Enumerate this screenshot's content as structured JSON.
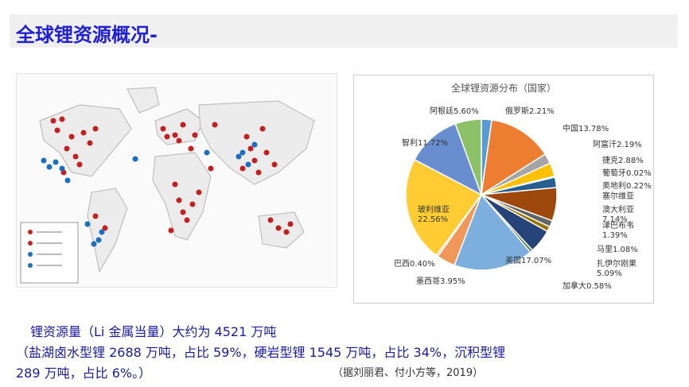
{
  "slide": {
    "title": "全球锂资源概况-"
  },
  "map": {
    "title": "",
    "deposit_colors": {
      "brine": "#1a6fc0",
      "hard_rock": "#c42020"
    }
  },
  "chart_data": {
    "type": "pie",
    "title": "全球锂资源分布（国家）",
    "slices": [
      {
        "label": "俄罗斯2.21%",
        "value": 2.21,
        "color": "#5b9bd5"
      },
      {
        "label": "中国13.78%",
        "value": 13.78,
        "color": "#ed7d31"
      },
      {
        "label": "阿富汗2.19%",
        "value": 2.19,
        "color": "#a5a5a5"
      },
      {
        "label": "捷克2.88%",
        "value": 2.88,
        "color": "#ffc000"
      },
      {
        "label": "葡萄牙0.02%",
        "value": 0.02,
        "color": "#4472c4"
      },
      {
        "label": "奥地利0.22%",
        "value": 0.22,
        "color": "#70ad47"
      },
      {
        "label": "塞尔维亚",
        "value": 2.2,
        "color": "#255e91"
      },
      {
        "label": "澳大利亚 7.14%",
        "value": 7.14,
        "color": "#9e480e"
      },
      {
        "label": "津巴布韦 1.39%",
        "value": 1.39,
        "color": "#636363"
      },
      {
        "label": "马里1.08%",
        "value": 1.08,
        "color": "#997300"
      },
      {
        "label": "扎伊尔刚果 5.09%",
        "value": 5.09,
        "color": "#264478"
      },
      {
        "label": "加拿大0.58%",
        "value": 0.58,
        "color": "#43682b"
      },
      {
        "label": "美国17.07%",
        "value": 17.07,
        "color": "#7cafdd"
      },
      {
        "label": "墨西哥3.95%",
        "value": 3.95,
        "color": "#f1975a"
      },
      {
        "label": "巴西0.40%",
        "value": 0.4,
        "color": "#b7b7b7"
      },
      {
        "label": "玻利维亚 22.56%",
        "value": 22.56,
        "color": "#ffcd33"
      },
      {
        "label": "智利11.72%",
        "value": 11.72,
        "color": "#698ed0"
      },
      {
        "label": "阿根廷5.60%",
        "value": 5.6,
        "color": "#8cc168"
      }
    ]
  },
  "text": {
    "line1": "锂资源量（Li 金属当量）大约为 4521 万吨",
    "line2": "（盐湖卤水型锂 2688 万吨，占比 59%，硬岩型锂 1545 万吨，占比 34%，沉积型锂",
    "line3": "289 万吨，占比 6%。）",
    "citation": "（据刘丽君、付小方等，2019）"
  }
}
